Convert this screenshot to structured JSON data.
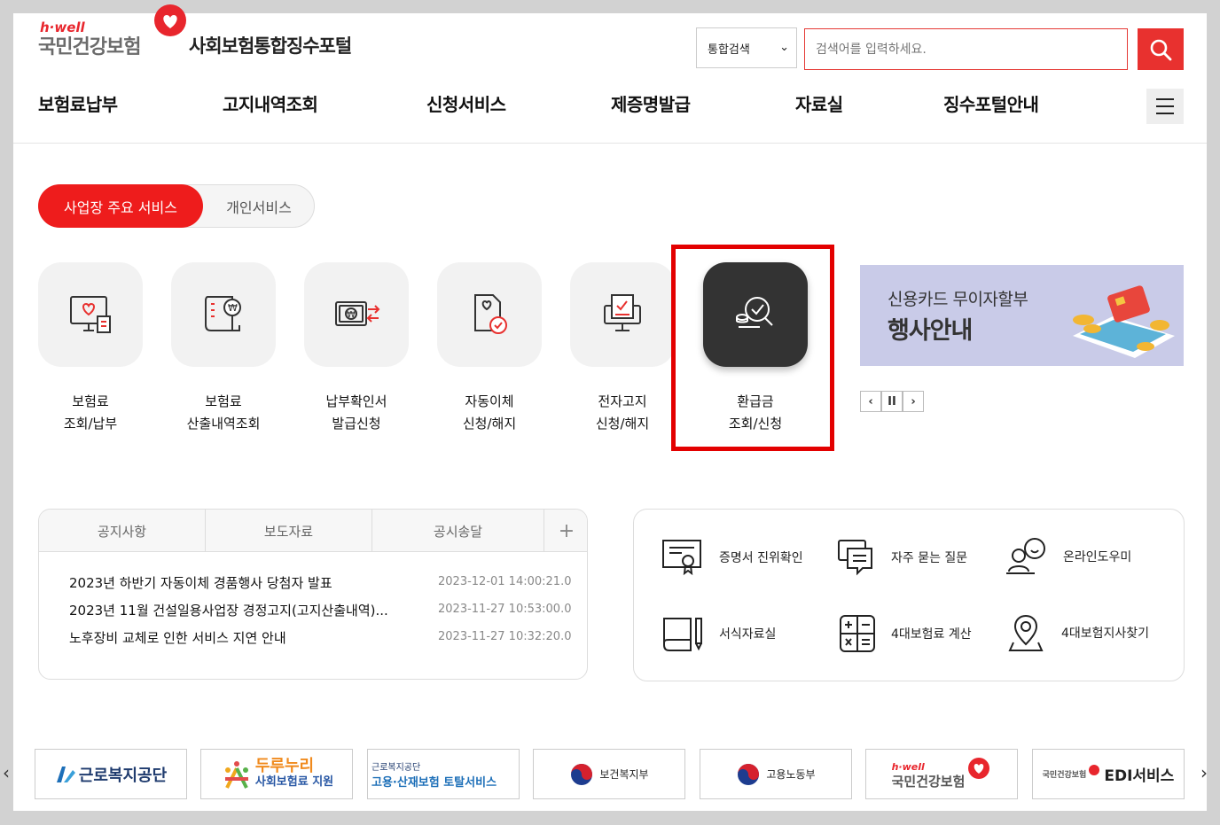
{
  "header": {
    "logo_hwell": "h·well",
    "logo_name": "국민건강보험",
    "portal_title": "사회보험통합징수포털",
    "search_select": "통합검색",
    "search_placeholder": "검색어를 입력하세요."
  },
  "gnb": [
    "보험료납부",
    "고지내역조회",
    "신청서비스",
    "제증명발급",
    "자료실",
    "징수포털안내"
  ],
  "service_tabs": {
    "active": "사업장 주요 서비스",
    "other": "개인서비스"
  },
  "quick_services": [
    {
      "line1": "보험료",
      "line2": "조회/납부",
      "icon": "monitor-heart-icon"
    },
    {
      "line1": "보험료",
      "line2": "산출내역조회",
      "icon": "document-won-icon"
    },
    {
      "line1": "납부확인서",
      "line2": "발급신청",
      "icon": "won-transfer-icon"
    },
    {
      "line1": "자동이체",
      "line2": "신청/해지",
      "icon": "document-check-icon"
    },
    {
      "line1": "전자고지",
      "line2": "신청/해지",
      "icon": "electronic-notice-icon"
    },
    {
      "line1": "환급금",
      "line2": "조회/신청",
      "icon": "refund-search-icon"
    }
  ],
  "banner": {
    "sub": "신용카드 무이자할부",
    "main": "행사안내",
    "controls": [
      "prev",
      "pause",
      "next"
    ]
  },
  "notice": {
    "tabs": [
      "공지사항",
      "보도자료",
      "공시송달"
    ],
    "more": "+",
    "rows": [
      {
        "title": "2023년 하반기 자동이체 경품행사 당첨자 발표",
        "date": "2023-12-01 14:00:21.0"
      },
      {
        "title": "2023년 11월 건설일용사업장 경정고지(고지산출내역)...",
        "date": "2023-11-27 10:53:00.0"
      },
      {
        "title": "노후장비 교체로 인한 서비스 지연 안내",
        "date": "2023-11-27 10:32:20.0"
      }
    ]
  },
  "utilities": [
    {
      "label": "증명서 진위확인",
      "icon": "certificate-icon"
    },
    {
      "label": "자주 묻는 질문",
      "icon": "chat-icon"
    },
    {
      "label": "온라인도우미",
      "icon": "helper-icon"
    },
    {
      "label": "서식자료실",
      "icon": "book-pen-icon"
    },
    {
      "label": "4대보험료 계산",
      "icon": "calculator-icon"
    },
    {
      "label": "4대보험지사찾기",
      "icon": "location-pin-icon"
    }
  ],
  "footer_banners": [
    {
      "text": "근로복지공단",
      "icon": "kcomwel-icon"
    },
    {
      "line1": "두루누리",
      "line2": "사회보험료 지원",
      "icon": "durunuri-icon"
    },
    {
      "line1": "근로복지공단",
      "line2": "고용·산재보험 토탈서비스"
    },
    {
      "text": "보건복지부",
      "icon": "taegeuk-icon"
    },
    {
      "text": "고용노동부",
      "icon": "taegeuk-icon"
    },
    {
      "line1": "h·well",
      "line2": "국민건강보험"
    },
    {
      "line1": "국민건강보험",
      "line2": "EDI서비스"
    }
  ],
  "colors": {
    "accent": "#e8312f",
    "highlight": "#e30000",
    "banner_bg": "#c9cbe8"
  }
}
